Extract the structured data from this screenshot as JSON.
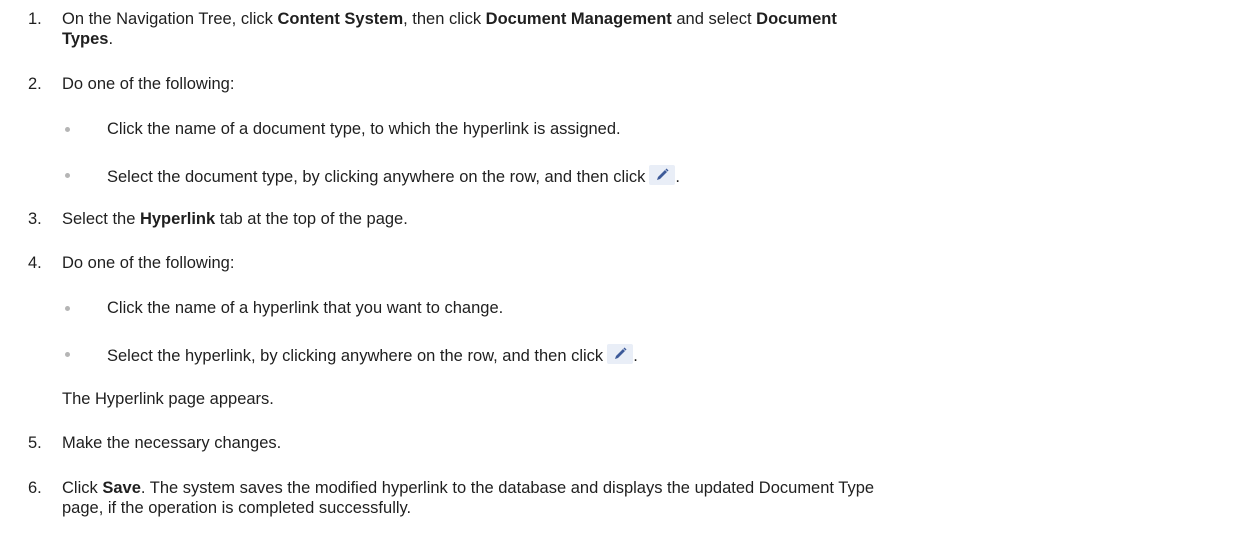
{
  "steps": [
    {
      "num": "1.",
      "parts": [
        "On the Navigation Tree, click ",
        "Content System",
        ", then click ",
        "Document Management",
        " and select ",
        "Document",
        "Types",
        "."
      ]
    },
    {
      "num": "2.",
      "text": "Do one of the following:"
    },
    {
      "num": "3.",
      "parts": [
        "Select the ",
        "Hyperlink",
        " tab at the top of the page."
      ]
    },
    {
      "num": "4.",
      "text": "Do one of the following:"
    },
    {
      "num": "5.",
      "text": "Make the necessary changes."
    },
    {
      "num": "6.",
      "parts": [
        "Click ",
        "Save",
        ". The system saves the modified hyperlink to the database and displays the updated Document Type",
        "page, if the operation is completed successfully."
      ]
    }
  ],
  "step2_options": [
    "Click the name of a document type, to which the hyperlink is assigned.",
    "Select the document type, by clicking anywhere on the row, and then click"
  ],
  "step4_options": [
    "Click the name of a hyperlink that you want to change.",
    "Select the hyperlink, by clicking anywhere on the row, and then click"
  ],
  "step4_note": "The Hyperlink page appears.",
  "period": ".",
  "icons": {
    "edit": "pencil-edit-icon"
  },
  "colors": {
    "icon_bg": "#e9eef7",
    "icon_fg": "#3d5a99",
    "bullet": "#b5b5b5"
  }
}
